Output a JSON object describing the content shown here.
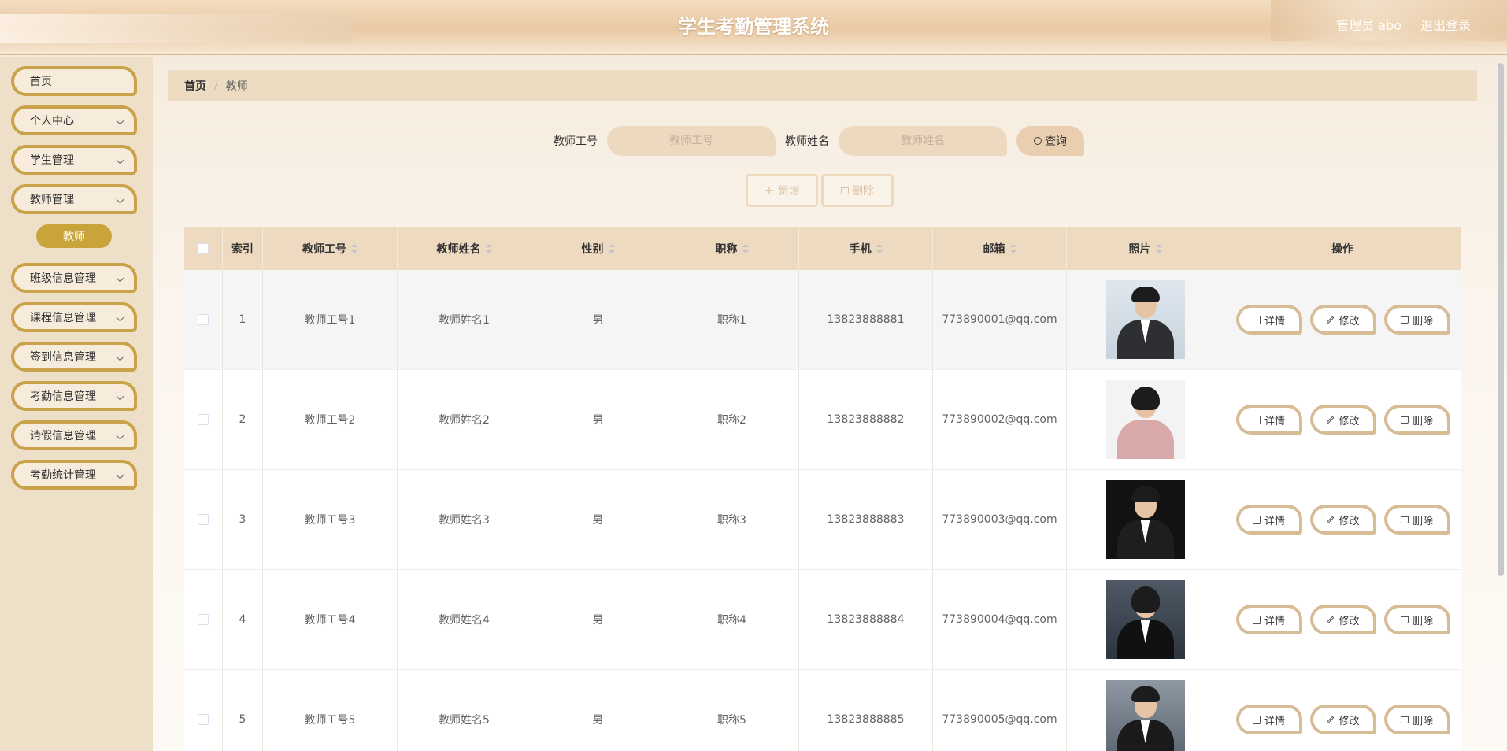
{
  "header": {
    "title": "学生考勤管理系统",
    "user_label": "管理员 abo",
    "logout_label": "退出登录"
  },
  "sidebar": {
    "items": [
      {
        "label": "首页"
      },
      {
        "label": "个人中心"
      },
      {
        "label": "学生管理"
      },
      {
        "label": "教师管理"
      },
      {
        "label": "班级信息管理"
      },
      {
        "label": "课程信息管理"
      },
      {
        "label": "签到信息管理"
      },
      {
        "label": "考勤信息管理"
      },
      {
        "label": "请假信息管理"
      },
      {
        "label": "考勤统计管理"
      }
    ],
    "active_sub": "教师"
  },
  "breadcrumb": {
    "home": "首页",
    "separator": "/",
    "current": "教师"
  },
  "search": {
    "teacher_no_label": "教师工号",
    "teacher_no_placeholder": "教师工号",
    "teacher_name_label": "教师姓名",
    "teacher_name_placeholder": "教师姓名",
    "query_label": "查询"
  },
  "actions": {
    "add_label": "新增",
    "delete_label": "删除"
  },
  "table": {
    "headers": {
      "index": "索引",
      "teacher_no": "教师工号",
      "teacher_name": "教师姓名",
      "sex": "性别",
      "title": "职称",
      "phone": "手机",
      "email": "邮箱",
      "photo": "照片",
      "operation": "操作"
    },
    "op_labels": {
      "detail": "详情",
      "edit": "修改",
      "delete": "删除"
    },
    "rows": [
      {
        "index": "1",
        "teacher_no": "教师工号1",
        "teacher_name": "教师姓名1",
        "sex": "男",
        "title": "职称1",
        "phone": "13823888881",
        "email": "773890001@qq.com"
      },
      {
        "index": "2",
        "teacher_no": "教师工号2",
        "teacher_name": "教师姓名2",
        "sex": "男",
        "title": "职称2",
        "phone": "13823888882",
        "email": "773890002@qq.com"
      },
      {
        "index": "3",
        "teacher_no": "教师工号3",
        "teacher_name": "教师姓名3",
        "sex": "男",
        "title": "职称3",
        "phone": "13823888883",
        "email": "773890003@qq.com"
      },
      {
        "index": "4",
        "teacher_no": "教师工号4",
        "teacher_name": "教师姓名4",
        "sex": "男",
        "title": "职称4",
        "phone": "13823888884",
        "email": "773890004@qq.com"
      },
      {
        "index": "5",
        "teacher_no": "教师工号5",
        "teacher_name": "教师姓名5",
        "sex": "男",
        "title": "职称5",
        "phone": "13823888885",
        "email": "773890005@qq.com"
      }
    ]
  },
  "colors": {
    "accent_gold": "#c9a24a",
    "header_bg": "#e9c9a3",
    "breadcrumb_bg": "#eddcc2",
    "table_header_bg": "#eedac1"
  }
}
